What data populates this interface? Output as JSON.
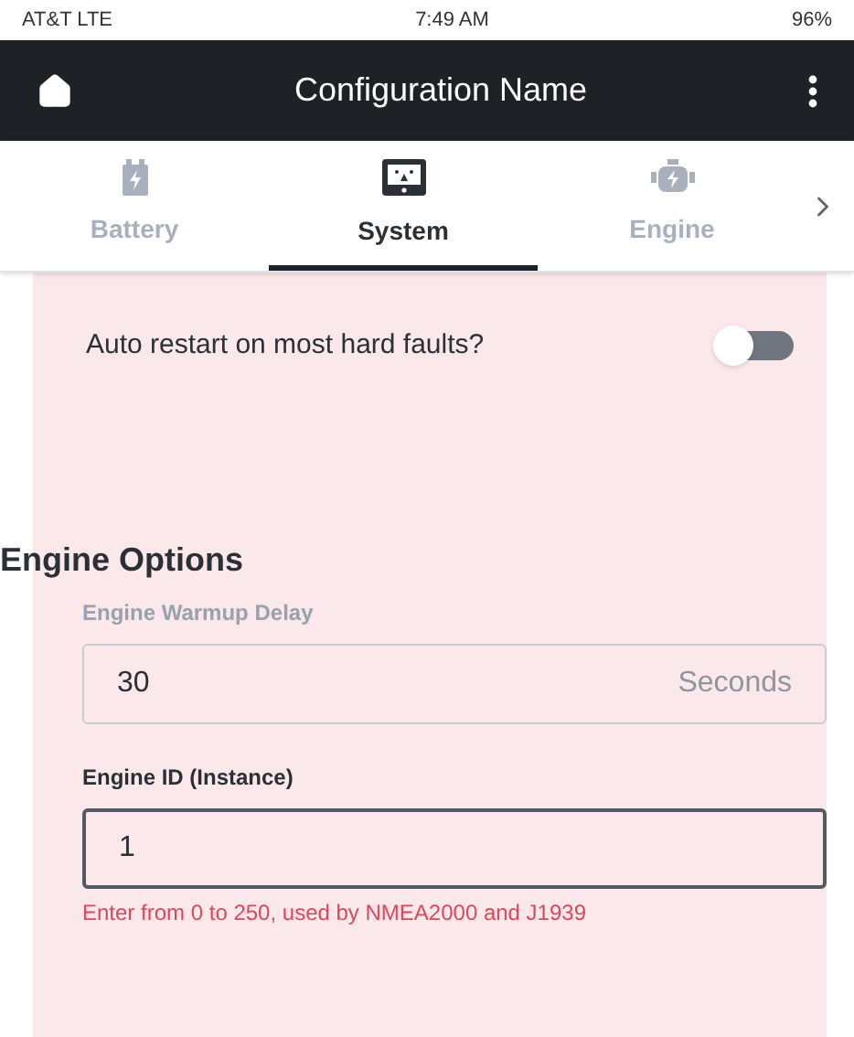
{
  "status_bar": {
    "carrier": "AT&T  LTE",
    "time": "7:49 AM",
    "battery": "96%"
  },
  "header": {
    "title": "Configuration Name"
  },
  "tabs": [
    {
      "label": "Battery",
      "kind": "battery",
      "selected": false
    },
    {
      "label": "System",
      "kind": "system",
      "selected": true
    },
    {
      "label": "Engine",
      "kind": "engine",
      "selected": false
    }
  ],
  "auto_restart": {
    "label": "Auto restart on most hard faults?",
    "on": false
  },
  "section": {
    "title": "Engine Options"
  },
  "fields": [
    {
      "label": "Engine Warmup Delay",
      "value": "30",
      "unit": "Seconds",
      "focused": false
    },
    {
      "label": "Engine ID (Instance)",
      "value": "1",
      "hint": "Enter from 0 to 250, used by NMEA2000 and J1939",
      "focused": true
    }
  ]
}
